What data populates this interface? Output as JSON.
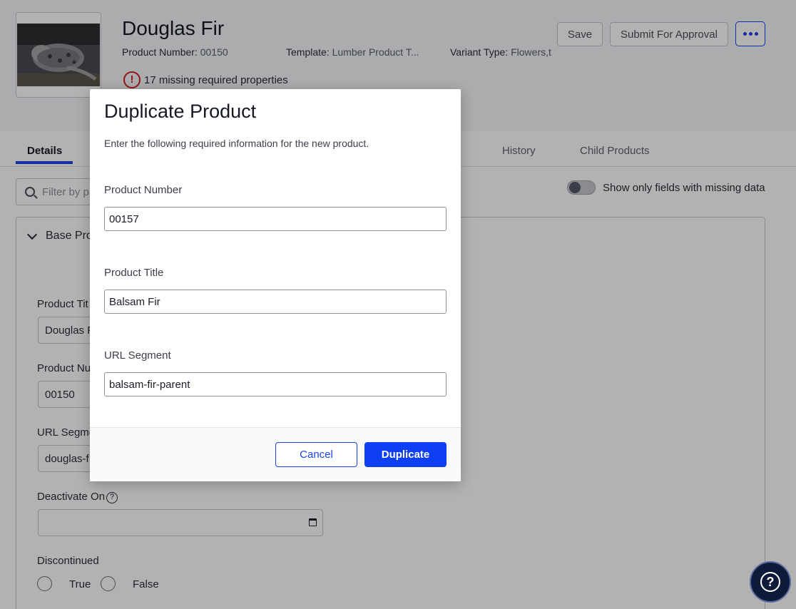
{
  "product": {
    "title": "Douglas Fir",
    "number_label": "Product Number:",
    "number_value": "00150",
    "template_label": "Template:",
    "template_value": "Lumber Product T...",
    "variant_label": "Variant Type:",
    "variant_value": "Flowers,t",
    "missing_text": "17 missing required properties"
  },
  "header_actions": {
    "save": "Save",
    "submit": "Submit For Approval"
  },
  "tabs": [
    {
      "label": "Details",
      "active": true
    },
    {
      "label": "History",
      "active": false
    },
    {
      "label": "Child Products",
      "active": false
    }
  ],
  "filter": {
    "placeholder": "Filter by pr"
  },
  "toggle": {
    "label": "Show only fields with missing data",
    "on": false
  },
  "section": {
    "label": "Base Pro"
  },
  "form": {
    "product_title_label": "Product Tit",
    "product_title_value": "Douglas F",
    "product_number_label": "Product Nu",
    "product_number_value": "00150",
    "url_segment_label": "URL Segme",
    "url_segment_value": "douglas-f",
    "deactivate_label": "Deactivate On",
    "discontinued_label": "Discontinued",
    "true_label": "True",
    "false_label": "False"
  },
  "modal": {
    "title": "Duplicate Product",
    "description": "Enter the following required information for the new product.",
    "product_number_label": "Product Number",
    "product_number_value": "00157",
    "product_title_label": "Product Title",
    "product_title_value": "Balsam Fir",
    "url_segment_label": "URL Segment",
    "url_segment_value": "balsam-fir-parent",
    "cancel": "Cancel",
    "duplicate": "Duplicate"
  },
  "icons": {
    "warning": "!",
    "help_small": "?",
    "help_fab": "?"
  },
  "colors": {
    "primary": "#0f3ff2",
    "error": "#d31d1d",
    "help_fab": "#0d1a3a"
  }
}
